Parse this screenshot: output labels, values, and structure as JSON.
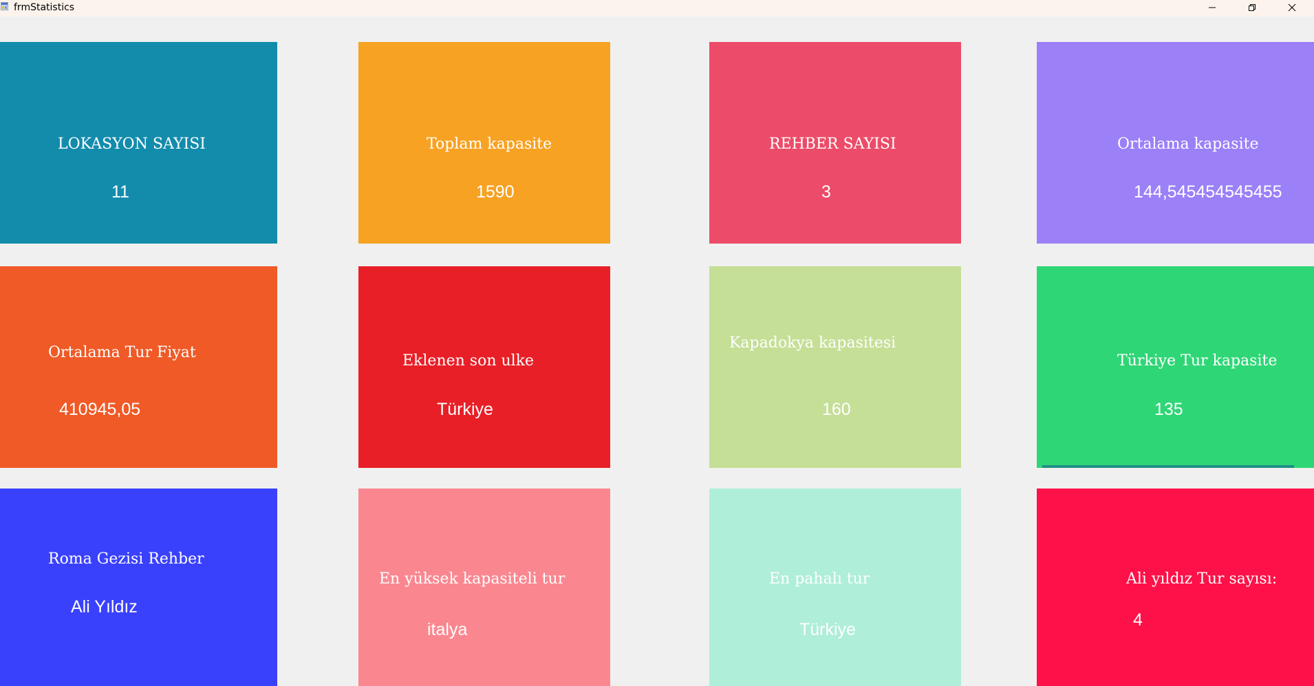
{
  "window": {
    "title": "frmStatistics",
    "icon": "app-form-icon",
    "controls": [
      "minimize-icon",
      "restore-icon",
      "close-icon"
    ]
  },
  "tiles": [
    {
      "label": "LOKASYON SAYISI",
      "value": "11",
      "color": "#138cac"
    },
    {
      "label": "Toplam kapasite",
      "value": "1590",
      "color": "#f7a223"
    },
    {
      "label": "REHBER SAYISI",
      "value": "3",
      "color": "#ec4c69"
    },
    {
      "label": "Ortalama kapasite",
      "value": "144,545454545455",
      "color": "#9b80f8"
    },
    {
      "label": "Ortalama Tur Fiyat",
      "value": "410945,05",
      "color": "#ef5a27"
    },
    {
      "label": "Eklenen son ulke",
      "value": "Türkiye",
      "color": "#e81f27"
    },
    {
      "label": "Kapadokya kapasitesi",
      "value": "160",
      "color": "#c5df97"
    },
    {
      "label": "Türkiye Tur kapasite",
      "value": "135",
      "color": "#2fd676"
    },
    {
      "label": "Roma Gezisi Rehber",
      "value": "Ali Yıldız",
      "color": "#3a41fd"
    },
    {
      "label": "En yüksek kapasiteli tur",
      "value": "italya",
      "color": "#fa8790"
    },
    {
      "label": "En pahalı tur",
      "value": "Türkiye",
      "color": "#afeed8"
    },
    {
      "label": "Ali yıldız Tur sayısı:",
      "value": "4",
      "color": "#fe1148"
    }
  ]
}
